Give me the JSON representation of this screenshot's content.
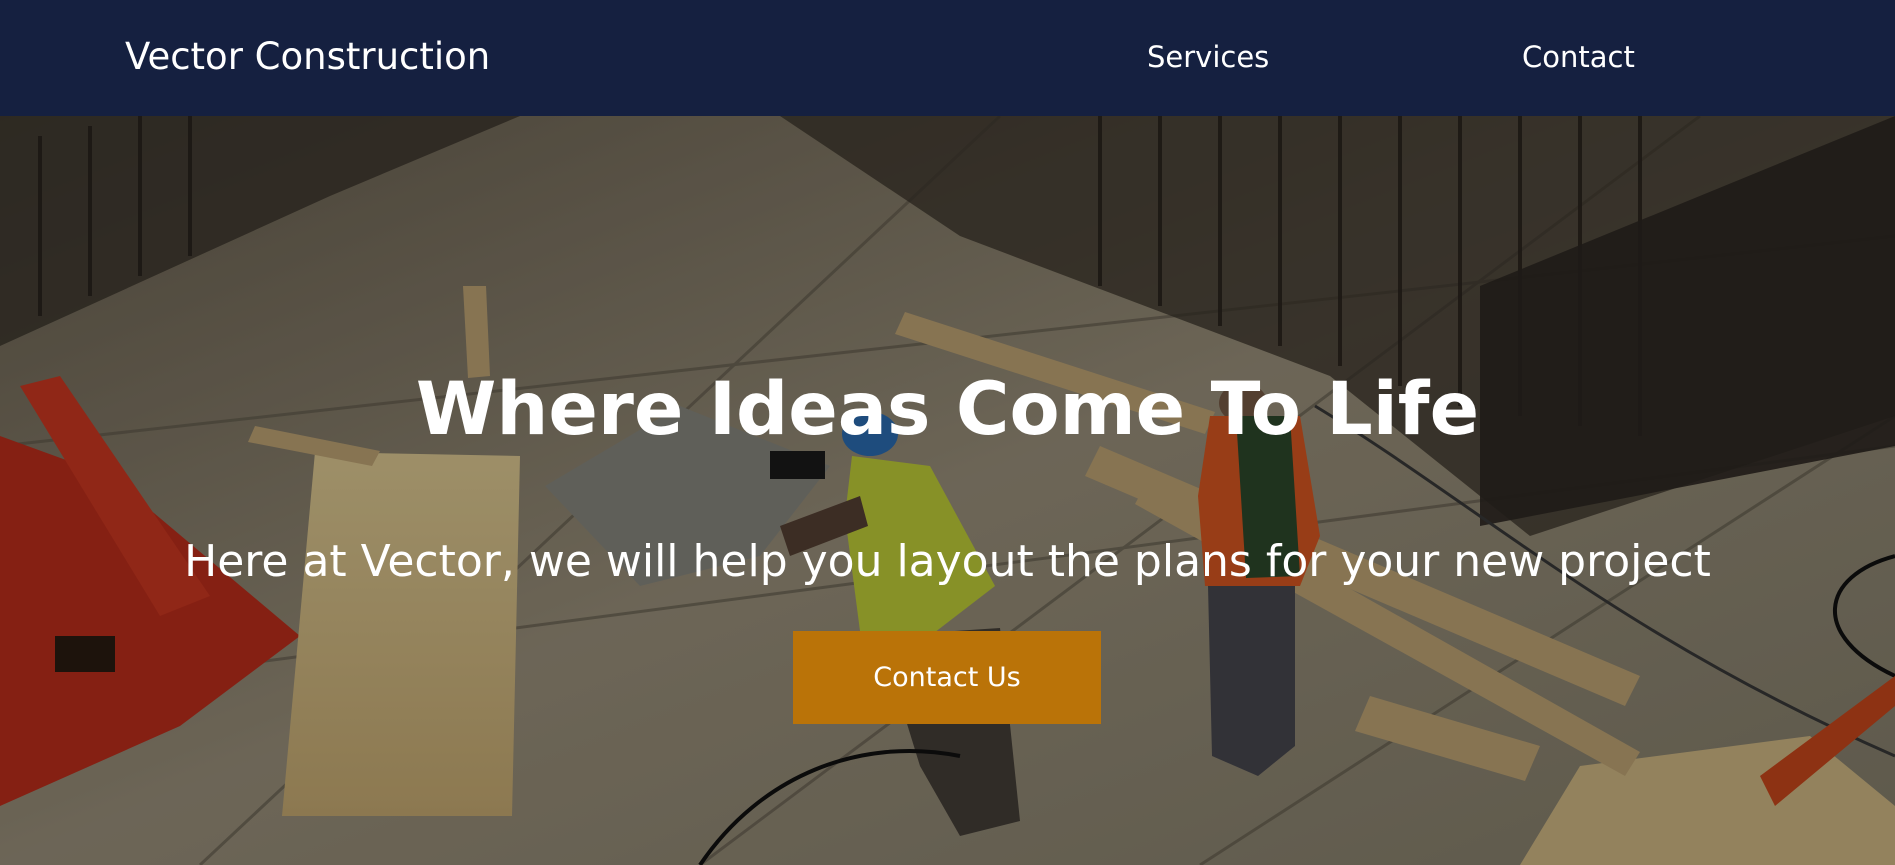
{
  "nav": {
    "brand": "Vector Construction",
    "links": [
      {
        "label": "Services"
      },
      {
        "label": "Contact"
      }
    ]
  },
  "hero": {
    "title": "Where Ideas Come To Life",
    "subtitle": "Here at Vector, we will help you layout the plans for your new project",
    "cta_label": "Contact Us"
  },
  "colors": {
    "navbar_bg": "#152040",
    "cta_bg": "#BA7308",
    "text": "#FFFFFF"
  }
}
